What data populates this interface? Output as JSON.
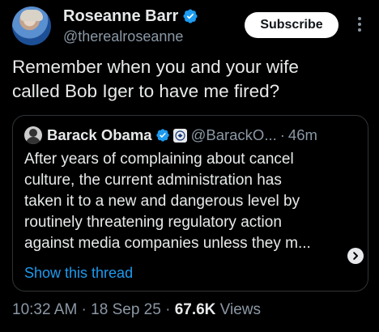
{
  "author": {
    "display_name": "Roseanne Barr",
    "handle": "@therealroseanne",
    "verified_icon": "verified-badge-icon"
  },
  "subscribe_label": "Subscribe",
  "tweet": {
    "lines": [
      "Remember when you and your wife",
      "called Bob Iger to have me fired?"
    ]
  },
  "quoted": {
    "display_name": "Barack Obama",
    "handle": "@BarackO...",
    "separator": "·",
    "time": "46m",
    "lines": [
      "After years of complaining about cancel",
      "culture, the current administration has",
      "taken it to a new and dangerous level by",
      "routinely threatening regulatory action",
      "against media companies unless they m..."
    ],
    "show_thread": "Show this thread"
  },
  "meta": {
    "time": "10:32 AM",
    "sep1": " · ",
    "date": "18 Sep 25",
    "sep2": " · ",
    "views_count": "67.6K",
    "views_label": " Views"
  },
  "colors": {
    "background": "#000000",
    "accent": "#1d9bf0",
    "secondary_text": "#8b98a5"
  }
}
